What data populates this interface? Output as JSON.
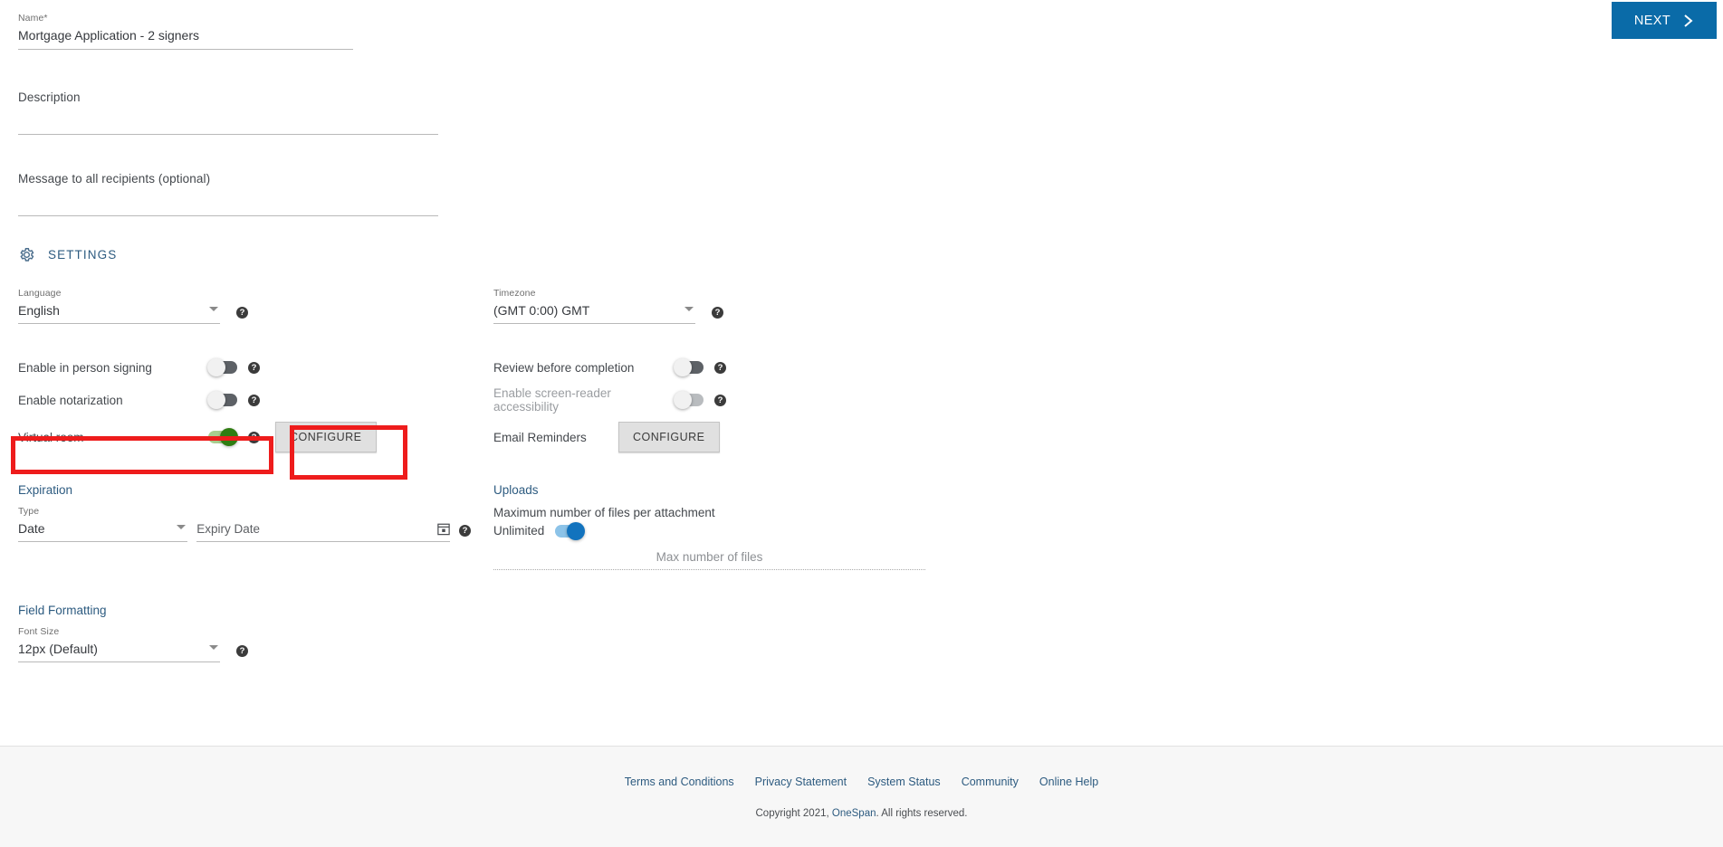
{
  "header": {
    "next_label": "NEXT",
    "next_icon": "chevron-right-icon",
    "accent_blue": "#0a6ba8"
  },
  "form": {
    "name_label": "Name",
    "name_required_mark": "*",
    "name_value": "Mortgage Application - 2 signers",
    "description_placeholder": "Description",
    "message_placeholder": "Message to all recipients (optional)"
  },
  "settings": {
    "icon": "gear-icon",
    "title": "SETTINGS",
    "title_color": "#2d5b80",
    "left": {
      "language_label": "Language",
      "language_value": "English",
      "in_person_signing_label": "Enable in person signing",
      "in_person_signing_state": "off",
      "notarization_label": "Enable notarization",
      "notarization_state": "off",
      "virtual_room_label": "Virtual room",
      "virtual_room_state": "on",
      "virtual_room_toggle_color": "#2f7d12",
      "virtual_room_configure_label": "CONFIGURE"
    },
    "right": {
      "timezone_label": "Timezone",
      "timezone_value": "(GMT 0:00) GMT",
      "review_before_completion_label": "Review before completion",
      "review_before_completion_state": "off",
      "screen_reader_label": "Enable screen-reader accessibility",
      "screen_reader_state": "off-disabled",
      "email_reminders_label": "Email Reminders",
      "email_reminders_configure_label": "CONFIGURE"
    }
  },
  "expiration": {
    "title": "Expiration",
    "type_label": "Type",
    "type_value": "Date",
    "expiry_placeholder": "Expiry Date",
    "calendar_icon": "calendar-icon"
  },
  "uploads": {
    "title": "Uploads",
    "max_files_caption": "Maximum number of files per attachment",
    "unlimited_label": "Unlimited",
    "unlimited_state": "on",
    "unlimited_toggle_color": "#1273be",
    "max_number_of_files_placeholder": "Max number of files"
  },
  "field_formatting": {
    "title": "Field Formatting",
    "font_size_label": "Font Size",
    "font_size_value": "12px (Default)"
  },
  "annotations": {
    "highlight_color": "#ee1c1c",
    "boxes": [
      "virtual-room-row",
      "virtual-room-configure-button"
    ]
  },
  "footer": {
    "links": [
      "Terms and Conditions",
      "Privacy Statement",
      "System Status",
      "Community",
      "Online Help"
    ],
    "copyright_prefix": "Copyright 2021, ",
    "copyright_brand": "OneSpan",
    "copyright_suffix": ". All rights reserved."
  }
}
